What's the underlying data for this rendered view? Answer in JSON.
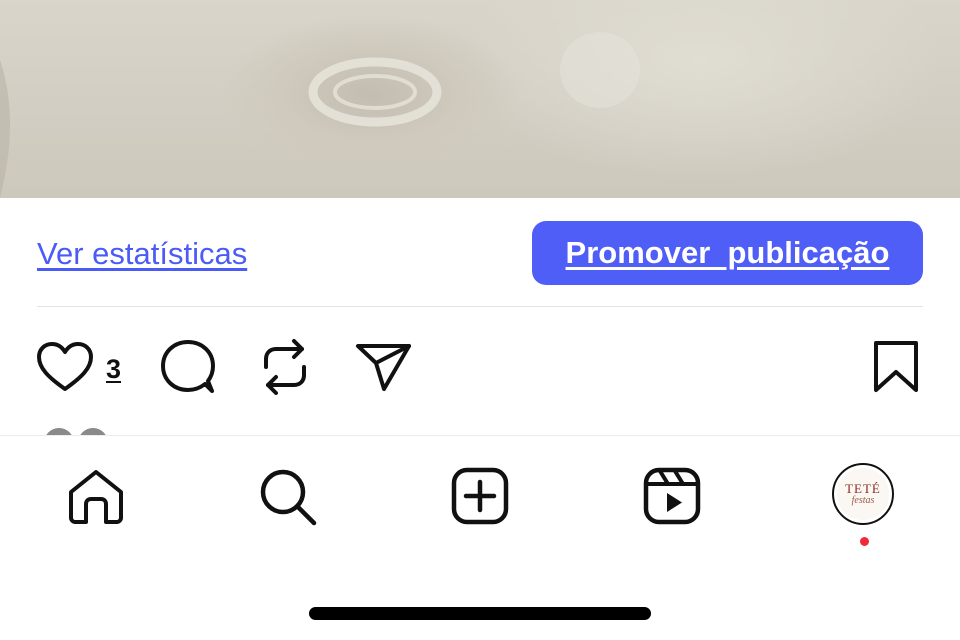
{
  "post": {
    "insights_link": "Ver estatísticas",
    "promote_button": "Promover  publicação",
    "like_count": "3"
  },
  "profile_logo": {
    "main": "TETÉ",
    "sub": "festas"
  },
  "icons": {
    "actions": [
      "heart-icon",
      "comment-icon",
      "repost-icon",
      "share-icon",
      "bookmark-icon"
    ],
    "nav": [
      "home-icon",
      "search-icon",
      "create-icon",
      "reels-icon",
      "profile-avatar"
    ]
  },
  "colors": {
    "accent": "#4f5ef7",
    "link": "#4a5cf5",
    "notification": "#ee2a3b"
  }
}
